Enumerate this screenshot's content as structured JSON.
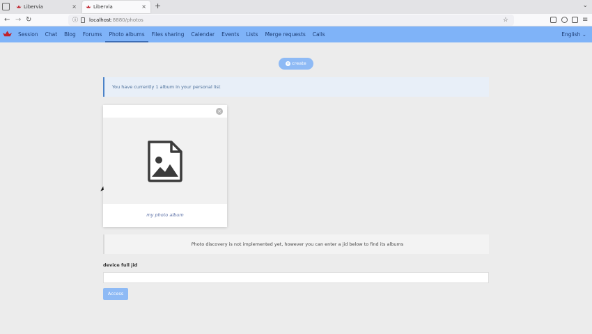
{
  "browser": {
    "tabs": [
      {
        "title": "Libervia",
        "active": false
      },
      {
        "title": "Libervia",
        "active": true
      }
    ],
    "new_tab_label": "+",
    "tab_close_label": "×",
    "url_host": "localhost",
    "url_path": ":8880/photos"
  },
  "menu": {
    "items": [
      "Session",
      "Chat",
      "Blog",
      "Forums",
      "Photo albums",
      "Files sharing",
      "Calendar",
      "Events",
      "Lists",
      "Merge requests",
      "Calls"
    ],
    "active_index": 4,
    "language": "English"
  },
  "page": {
    "create_label": "create",
    "notice": "You have currently 1 album in your personal list",
    "album": {
      "title": "my photo album",
      "icon": "image-file-icon"
    },
    "discovery_text": "Photo discovery is not implemented yet, however you can enter a jid below to find its albums",
    "jid_label": "device full jid",
    "jid_value": "",
    "access_label": "Access"
  },
  "colors": {
    "app_bar": "#7fb3f8",
    "button": "#8ebaf5",
    "notice_bg": "#e8eff8",
    "brand": "#c0212b"
  }
}
